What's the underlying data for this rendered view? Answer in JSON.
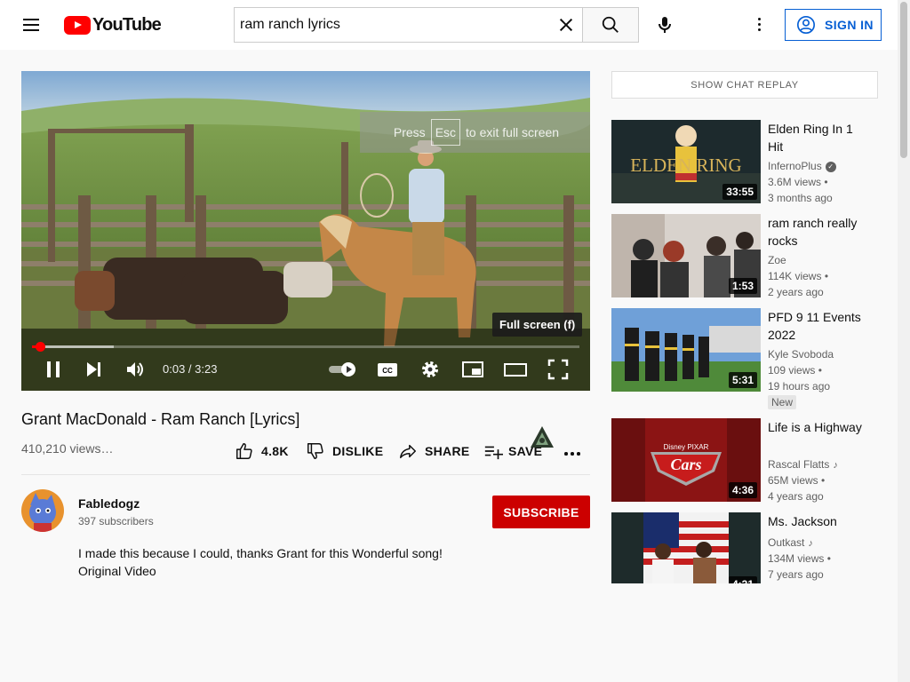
{
  "header": {
    "logo_text": "YouTube",
    "search_value": "ram ranch lyrics",
    "signin_label": "SIGN IN"
  },
  "player": {
    "fullscreen_notice": {
      "prefix": "Press",
      "key": "Esc",
      "suffix": "to exit full screen"
    },
    "tooltip": "Full screen (f)",
    "time": "0:03 / 3:23",
    "progress_played_fraction": 0.015,
    "progress_loaded_fraction": 0.15
  },
  "video": {
    "title": "Grant MacDonald - Ram Ranch [Lyrics]",
    "views": "410,210 views…",
    "like_count": "4.8K",
    "dislike_label": "DISLIKE",
    "share_label": "SHARE",
    "save_label": "SAVE"
  },
  "channel": {
    "name": "Fabledogz",
    "subscribers": "397 subscribers",
    "subscribe_label": "SUBSCRIBE",
    "description_line1": "I made this because I could, thanks Grant for this Wonderful song!",
    "description_line2": "Original Video"
  },
  "chat": {
    "replay_label": "SHOW CHAT REPLAY"
  },
  "recommendations": [
    {
      "title": "Elden Ring In 1 Hit",
      "channel": "InfernoPlus",
      "views": "3.6M views",
      "age": "3 months ago",
      "duration": "33:55",
      "thumb_text": "ELDEN RING"
    },
    {
      "title": "ram ranch really rocks",
      "channel": "Zoe",
      "views": "114K views",
      "age": "2 years ago",
      "duration": "1:53"
    },
    {
      "title": "PFD 9 11 Events 2022",
      "channel": "Kyle Svoboda",
      "views": "109 views",
      "age": "19 hours ago",
      "duration": "5:31",
      "badge": "New"
    },
    {
      "title": "Life is a Highway",
      "channel": "Rascal Flatts",
      "views": "65M views",
      "age": "4 years ago",
      "duration": "4:36",
      "thumb_text": "Cars",
      "thumb_subtext": "Disney PIXAR"
    },
    {
      "title": "Ms. Jackson",
      "channel": "Outkast",
      "views": "134M views",
      "age": "7 years ago",
      "duration": "4:31"
    }
  ],
  "colors": {
    "brand_red": "#ff0000",
    "subscribe_red": "#cc0000",
    "link_blue": "#065fd4",
    "progress_red": "#ff0000"
  },
  "icons": [
    "menu-icon",
    "search-icon",
    "clear-icon",
    "mic-icon",
    "more-vert-icon",
    "user-circle-icon",
    "pause-icon",
    "next-icon",
    "volume-icon",
    "autoplay-toggle-icon",
    "captions-icon",
    "settings-icon",
    "miniplayer-icon",
    "theater-icon",
    "fullscreen-icon",
    "thumbs-up-icon",
    "thumbs-down-icon",
    "share-icon",
    "playlist-add-icon",
    "verified-icon",
    "music-note-icon"
  ]
}
